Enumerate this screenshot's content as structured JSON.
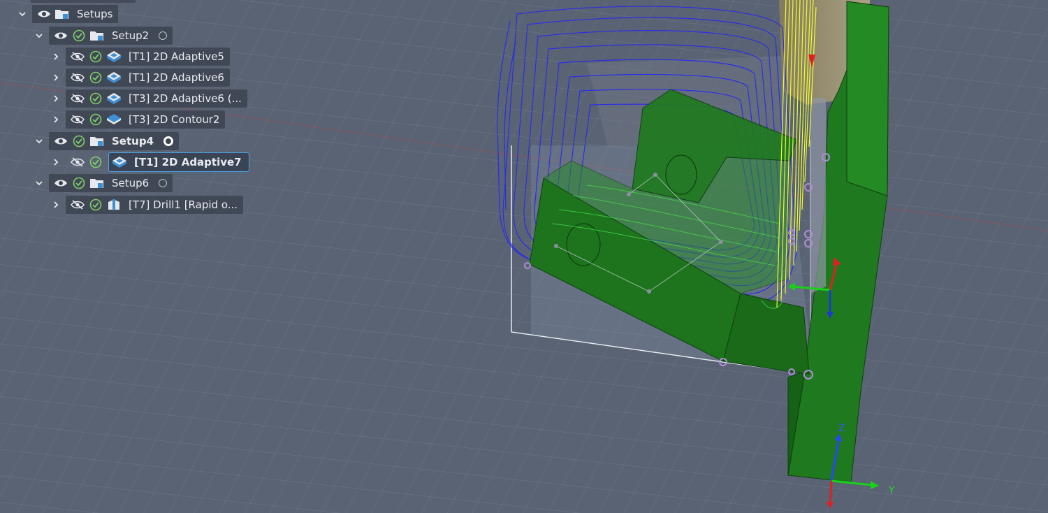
{
  "tree": {
    "root": {
      "label": "Setups"
    },
    "rows": [
      {
        "label": "Setup2",
        "radio": "inactive"
      },
      {
        "label": "[T1] 2D Adaptive5"
      },
      {
        "label": "[T1] 2D Adaptive6"
      },
      {
        "label": "[T3] 2D Adaptive6 (..."
      },
      {
        "label": "[T3] 2D Contour2"
      },
      {
        "label": "Setup4",
        "radio": "active"
      },
      {
        "label": "[T1] 2D Adaptive7"
      },
      {
        "label": "Setup6",
        "radio": "inactive"
      },
      {
        "label": "[T7] Drill1 [Rapid o..."
      }
    ]
  },
  "triad": {
    "z_label": "Z",
    "y_label": "Y"
  },
  "colors": {
    "background": "#5a6373",
    "part_green": "#1f7a1f",
    "toolpath_blue": "#2a2ee6",
    "toolpath_yellow": "#f2ff2a",
    "selection_outline": "#4aa3e6",
    "check_green": "#7fcf6a"
  }
}
